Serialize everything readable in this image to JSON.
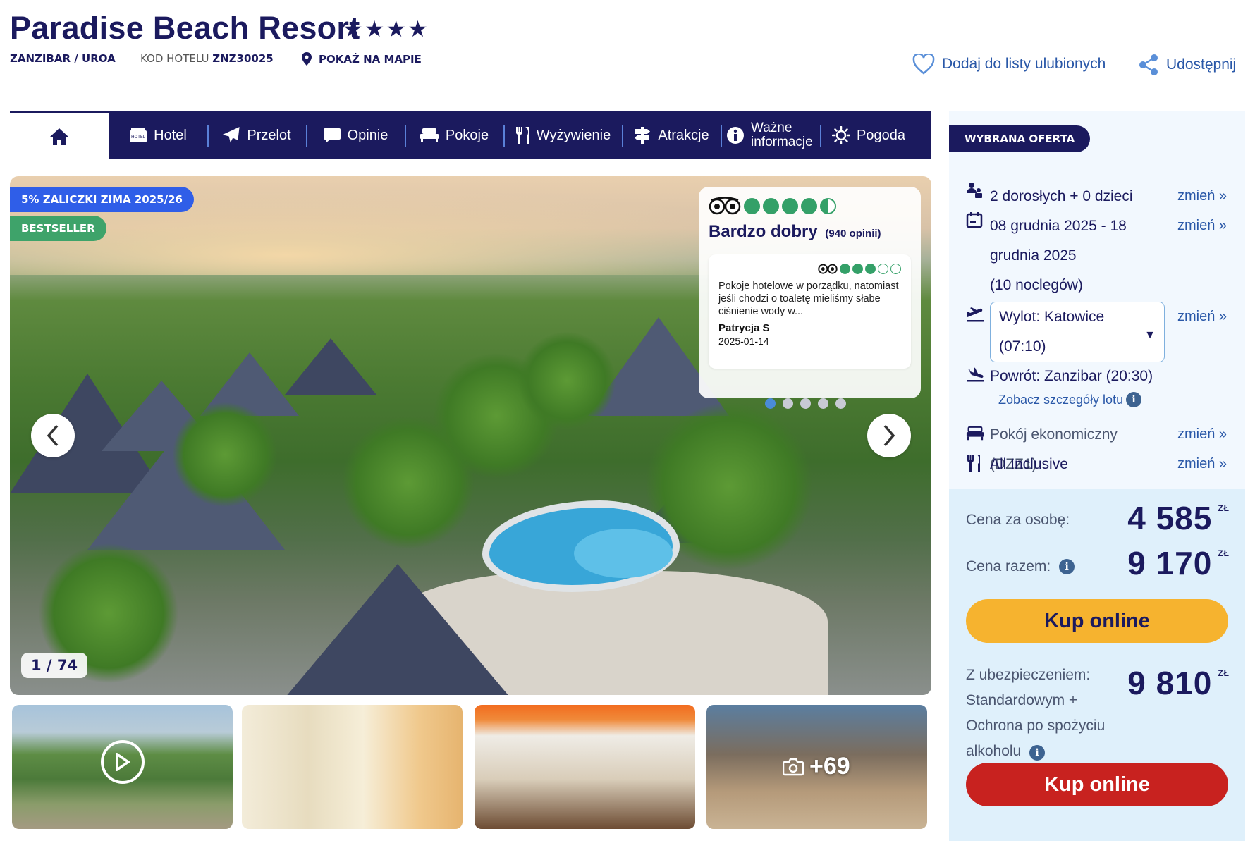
{
  "hotel": {
    "name": "Paradise Beach Resort",
    "stars": "★★★★",
    "location": "ZANZIBAR / UROA",
    "code_label": "KOD HOTELU",
    "code": "ZNZ30025",
    "map_link": "POKAŻ NA MAPIE"
  },
  "actions": {
    "favorite": "Dodaj do listy ulubionych",
    "share": "Udostępnij"
  },
  "nav": {
    "home_icon": "home-icon",
    "items": [
      {
        "label": "Hotel",
        "icon": "hotel-icon"
      },
      {
        "label": "Przelot",
        "icon": "plane-icon"
      },
      {
        "label": "Opinie",
        "icon": "chat-icon"
      },
      {
        "label": "Pokoje",
        "icon": "bed-icon"
      },
      {
        "label": "Wyżywienie",
        "icon": "cutlery-icon"
      },
      {
        "label": "Atrakcje",
        "icon": "signpost-icon"
      },
      {
        "label": "Ważne informacje",
        "icon": "info-icon"
      },
      {
        "label": "Pogoda",
        "icon": "sun-icon"
      }
    ]
  },
  "gallery": {
    "badge_promo": "5% ZALICZKI ZIMA 2025/26",
    "badge_best": "BESTSELLER",
    "counter": "1 / 74",
    "more_photos": "+69",
    "carousel_dots": 5,
    "active_dot": 0
  },
  "review": {
    "tripadvisor_rating": 4.5,
    "rating_label": "Bardzo dobry",
    "rating_count": "(940 opinii)",
    "item_rating": 3,
    "text": "Pokoje hotelowe w porządku, natomiast jeśli chodzi o toaletę mieliśmy słabe ciśnienie wody w...",
    "author": "Patrycja S",
    "date": "2025-01-14"
  },
  "offer": {
    "badge": "WYBRANA OFERTA",
    "change_label": "zmień »",
    "travelers": "2 dorosłych + 0 dzieci",
    "dates_line1": "08 grudnia 2025 - 18",
    "dates_line2": "grudnia 2025",
    "nights": "(10 noclegów)",
    "departure_line1": "Wylot: Katowice",
    "departure_line2": "(07:10)",
    "return": "Powrót: Zanzibar (20:30)",
    "flight_details": "Zobacz szczegóły lotu",
    "room": "Pokój ekonomiczny (DZZ1)",
    "board": "All Inclusive"
  },
  "prices": {
    "per_person_label": "Cena za osobę:",
    "per_person": "4 585",
    "total_label": "Cena razem:",
    "total": "9 170",
    "currency": "ZŁ",
    "buy_label": "Kup online",
    "insurance_label": "Z ubezpieczeniem: Standardowym + Ochrona po spożyciu alkoholu",
    "insurance_price": "9 810",
    "buy_label_2": "Kup online"
  },
  "colors": {
    "navy": "#1b1a5e",
    "link": "#2a58a8",
    "green": "#34a068",
    "yellow": "#f6b32f",
    "red": "#c8221f"
  }
}
